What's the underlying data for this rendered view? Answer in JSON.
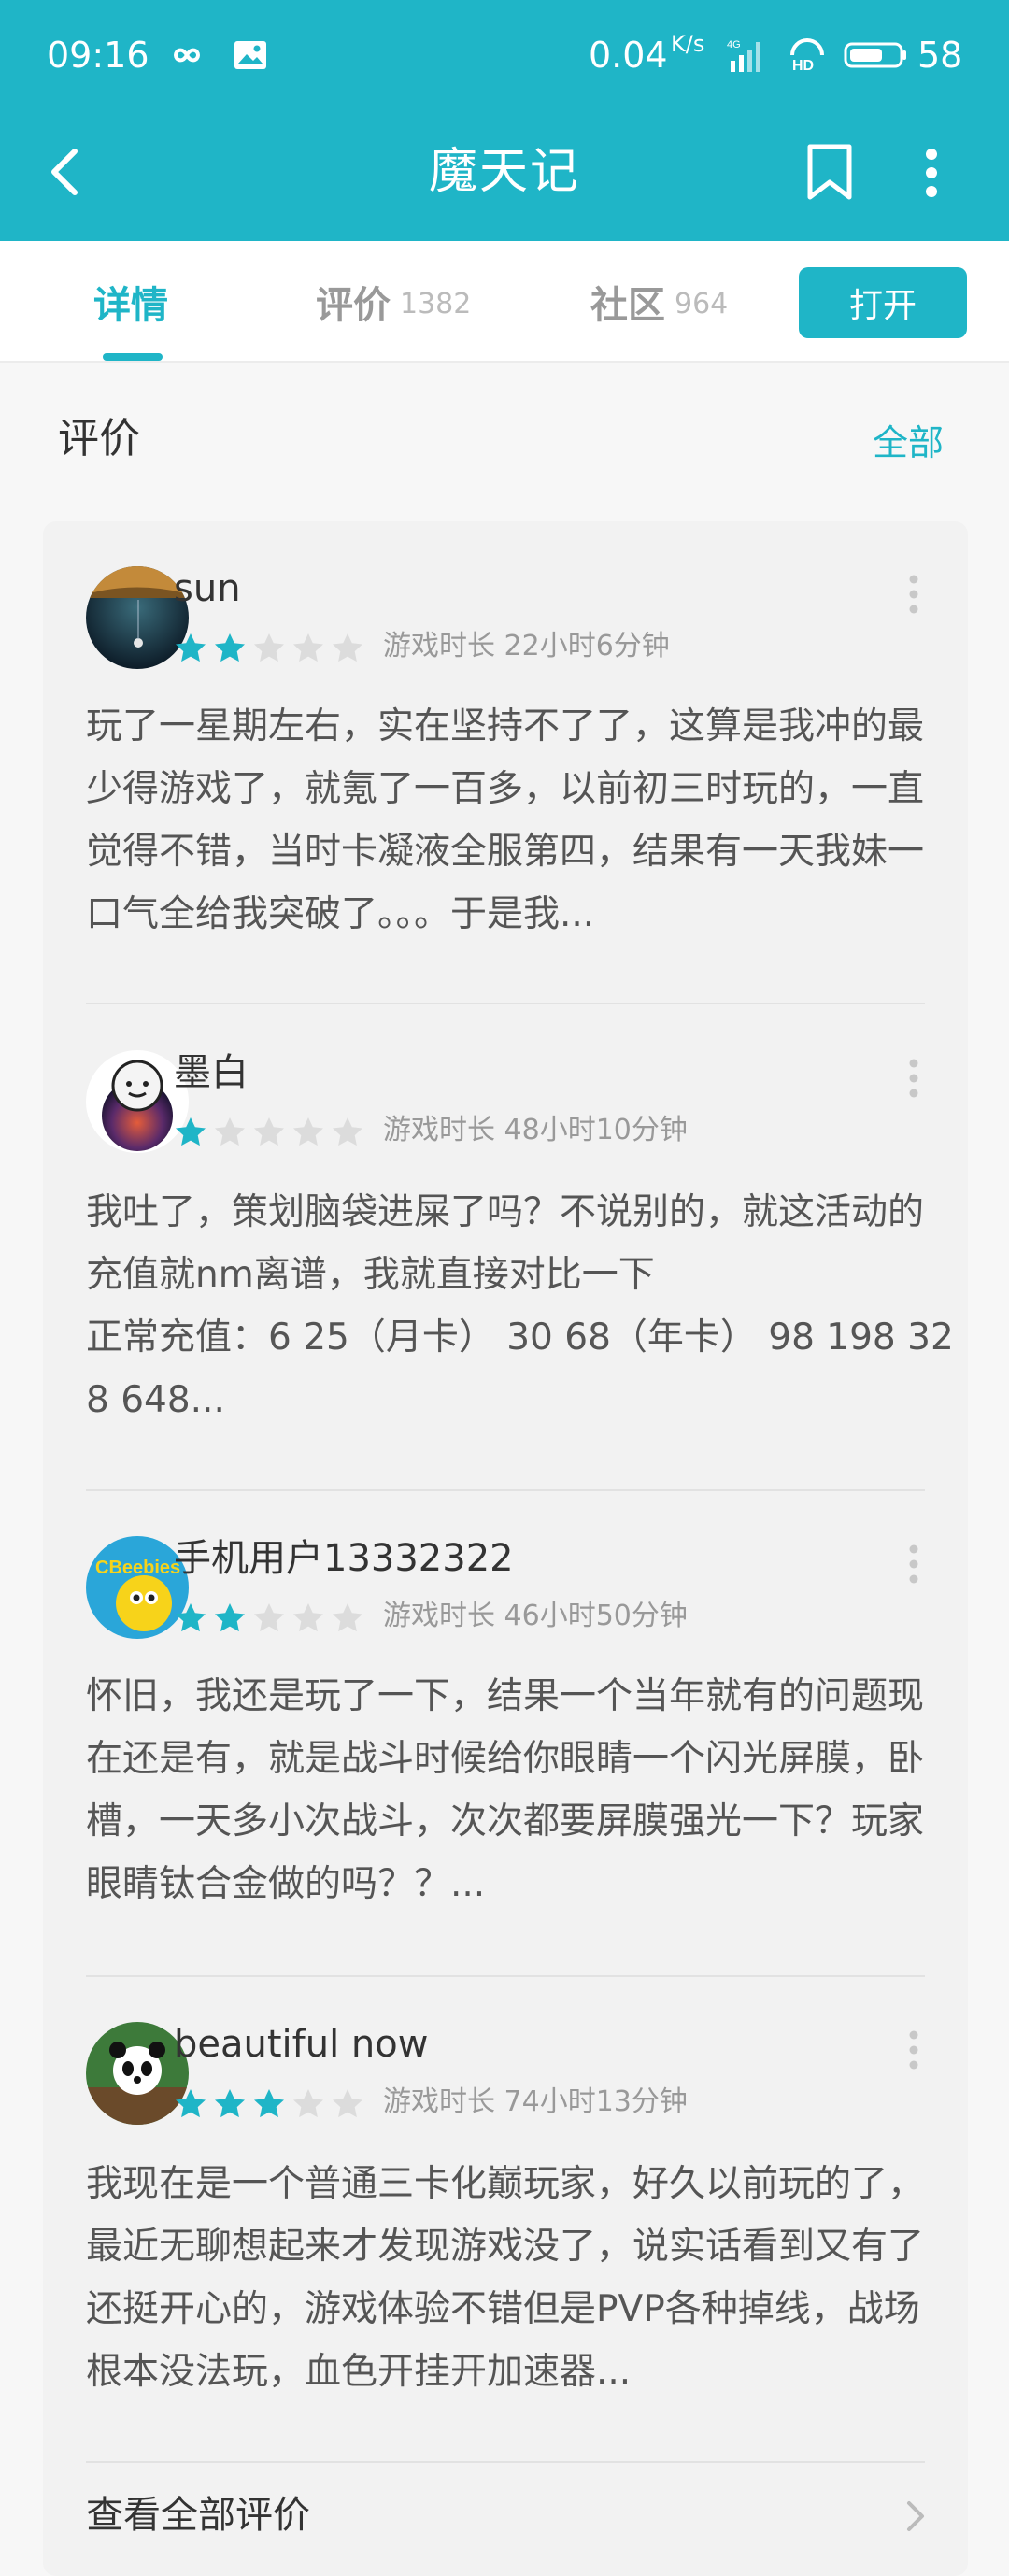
{
  "status_bar": {
    "time": "09:16",
    "net_speed": "0.04",
    "net_unit": "K/s",
    "battery": "58",
    "icons": [
      "infinity-icon",
      "image-icon",
      "signal-4g-icon",
      "hd-icon",
      "battery-icon"
    ]
  },
  "title_bar": {
    "title": "魔天记",
    "icons": [
      "back-arrow-icon",
      "bookmark-icon",
      "more-vertical-icon"
    ]
  },
  "tabs": [
    {
      "label": "详情",
      "count": "",
      "active": true
    },
    {
      "label": "评价",
      "count": "1382",
      "active": false
    },
    {
      "label": "社区",
      "count": "964",
      "active": false
    }
  ],
  "open_button": "打开",
  "section": {
    "title": "评价",
    "all_link": "全部"
  },
  "reviews": [
    {
      "username": "sun",
      "rating": 2,
      "play_time": "游戏时长 22小时6分钟",
      "text": "玩了一星期左右，实在坚持不了了，这算是我冲的最少得游戏了，就氪了一百多，以前初三时玩的，一直觉得不错，当时卡凝液全服第四，结果有一天我妹一口气全给我突破了。。。于是我..."
    },
    {
      "username": "墨白",
      "rating": 1,
      "play_time": "游戏时长 48小时10分钟",
      "text": "我吐了，策划脑袋进屎了吗？不说别的，就这活动的充值就nm离谱，我就直接对比一下\n正常充值：6 25（月卡） 30 68（年卡） 98 198 328 648..."
    },
    {
      "username": "手机用户13332322",
      "rating": 2,
      "play_time": "游戏时长 46小时50分钟",
      "text": "怀旧，我还是玩了一下，结果一个当年就有的问题现在还是有，就是战斗时候给你眼睛一个闪光屏膜，卧槽，一天多小次战斗，次次都要屏膜强光一下？玩家眼睛钛合金做的吗？？..."
    },
    {
      "username": "beautiful now",
      "rating": 3,
      "play_time": "游戏时长 74小时13分钟",
      "text": "我现在是一个普通三卡化巅玩家，好久以前玩的了，最近无聊想起来才发现游戏没了，说实话看到又有了还挺开心的，游戏体验不错但是PVP各种掉线，战场根本没法玩，血色开挂开加速器..."
    }
  ],
  "see_all": "查看全部评价",
  "colors": {
    "accent": "#1fb5c7",
    "star_filled": "#1fb5c7",
    "star_empty": "#dcdcdc"
  }
}
